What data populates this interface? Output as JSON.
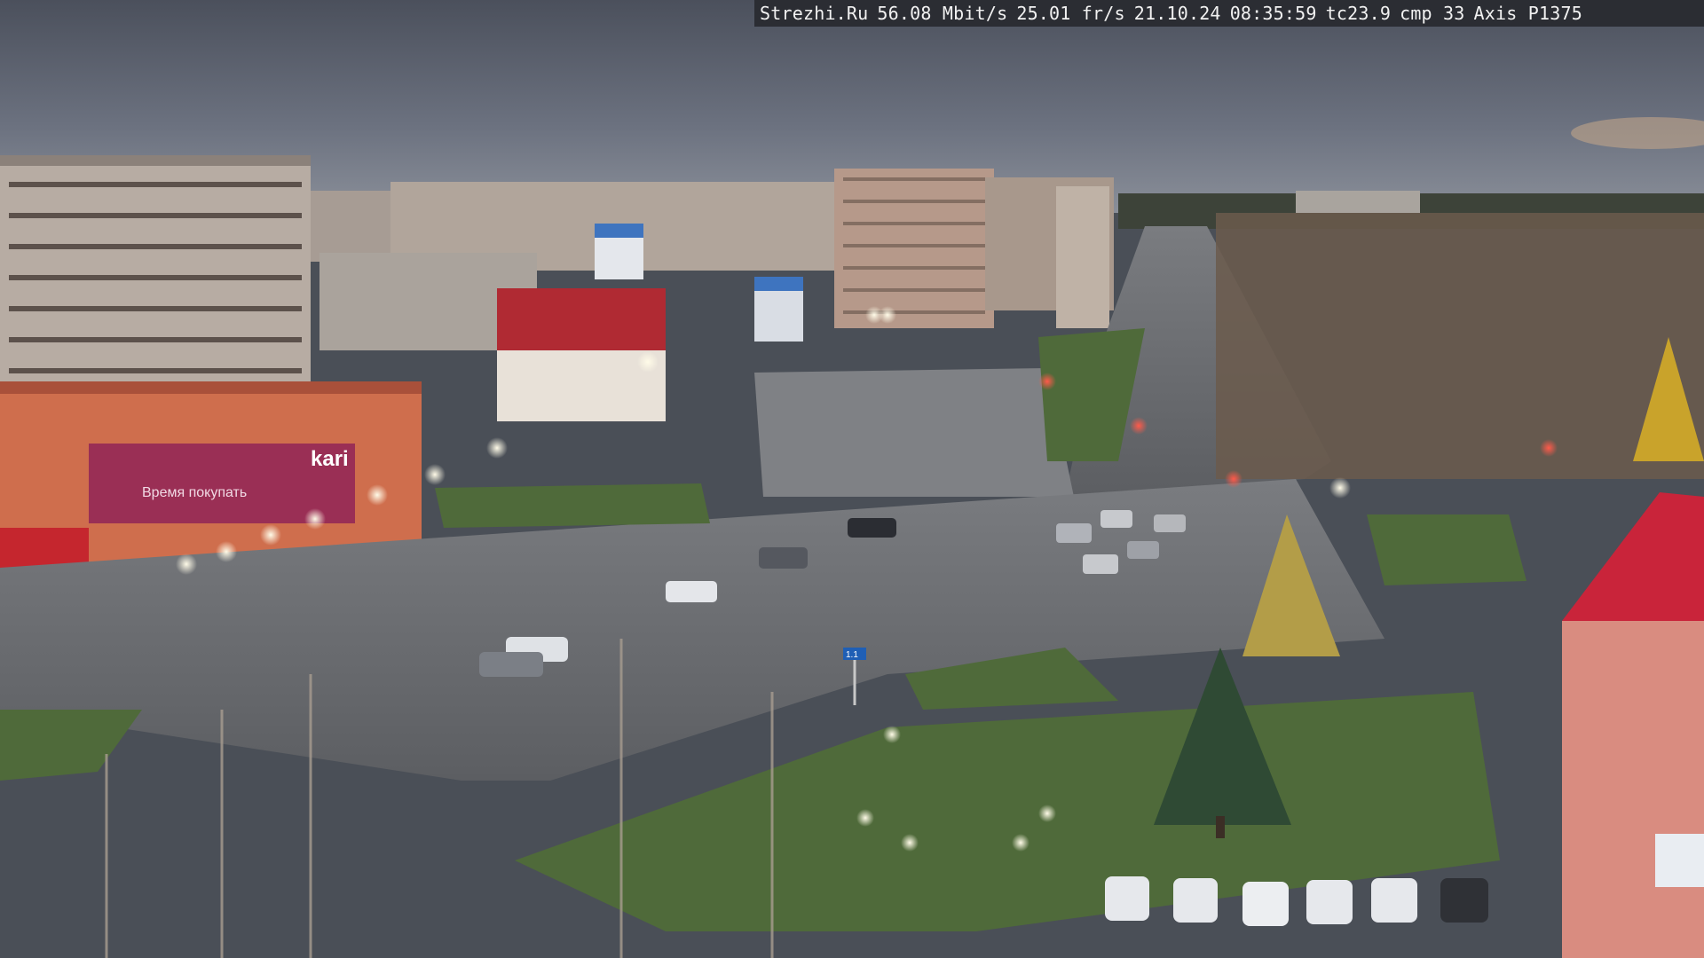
{
  "camera_overlay": {
    "site": "Strezhi.Ru",
    "bitrate": "56.08 Mbit/s",
    "framerate": "25.01 fr/s",
    "date": "21.10.24",
    "time": "08:35:59",
    "tc": "tc23.9",
    "cmp": "cmp 33",
    "camera_model": "Axis P1375"
  },
  "signs": {
    "store_sign": "kari",
    "store_slogan": "Время покупать",
    "bus_stop_sign": "1.1"
  },
  "colors": {
    "sky": "#5b6170",
    "road": "#6d6f73",
    "grass": "#4f6a3a",
    "building_orange": "#d86a45",
    "roof_red": "#b3222d"
  }
}
